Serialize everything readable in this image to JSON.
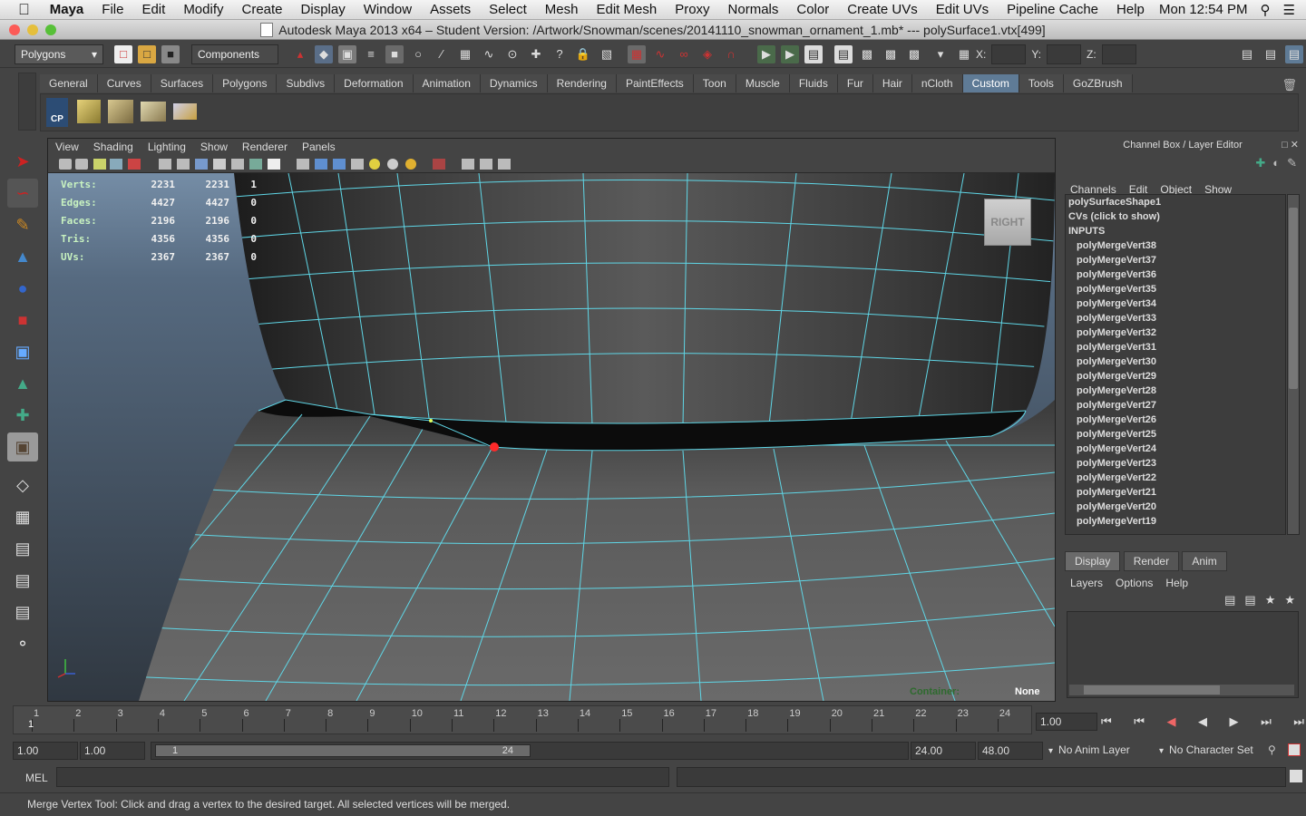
{
  "mac_menu": {
    "app": "Maya",
    "items": [
      "File",
      "Edit",
      "Modify",
      "Create",
      "Display",
      "Window",
      "Assets",
      "Select",
      "Mesh",
      "Edit Mesh",
      "Proxy",
      "Normals",
      "Color",
      "Create UVs",
      "Edit UVs",
      "Pipeline Cache",
      "Help"
    ],
    "clock": "Mon 12:54 PM"
  },
  "window_title": "Autodesk Maya 2013 x64 – Student Version: /Artwork/Snowman/scenes/20141110_snowman_ornament_1.mb*  ---   polySurface1.vtx[499]",
  "status_line": {
    "menu_set": "Polygons",
    "selection_mode": "Components",
    "x_label": "X:",
    "y_label": "Y:",
    "z_label": "Z:"
  },
  "shelf_tabs": [
    "General",
    "Curves",
    "Surfaces",
    "Polygons",
    "Subdivs",
    "Deformation",
    "Animation",
    "Dynamics",
    "Rendering",
    "PaintEffects",
    "Toon",
    "Muscle",
    "Fluids",
    "Fur",
    "Hair",
    "nCloth",
    "Custom",
    "Tools",
    "GoZBrush"
  ],
  "shelf_active": "Custom",
  "shelf_cp_label": "CP",
  "viewport": {
    "menu": [
      "View",
      "Shading",
      "Lighting",
      "Show",
      "Renderer",
      "Panels"
    ],
    "hud": [
      {
        "label": "Verts:",
        "a": "2231",
        "b": "2231",
        "c": "1"
      },
      {
        "label": "Edges:",
        "a": "4427",
        "b": "4427",
        "c": "0"
      },
      {
        "label": "Faces:",
        "a": "2196",
        "b": "2196",
        "c": "0"
      },
      {
        "label": "Tris:",
        "a": "4356",
        "b": "4356",
        "c": "0"
      },
      {
        "label": "UVs:",
        "a": "2367",
        "b": "2367",
        "c": "0"
      }
    ],
    "view_cube": "RIGHT",
    "container_label": "Container:",
    "container_value": "None"
  },
  "channel_box": {
    "title": "Channel Box / Layer Editor",
    "menu": [
      "Channels",
      "Edit",
      "Object",
      "Show"
    ],
    "items": [
      "polySurfaceShape1",
      "CVs (click to show)",
      "INPUTS",
      "polyMergeVert38",
      "polyMergeVert37",
      "polyMergeVert36",
      "polyMergeVert35",
      "polyMergeVert34",
      "polyMergeVert33",
      "polyMergeVert32",
      "polyMergeVert31",
      "polyMergeVert30",
      "polyMergeVert29",
      "polyMergeVert28",
      "polyMergeVert27",
      "polyMergeVert26",
      "polyMergeVert25",
      "polyMergeVert24",
      "polyMergeVert23",
      "polyMergeVert22",
      "polyMergeVert21",
      "polyMergeVert20",
      "polyMergeVert19"
    ]
  },
  "layer_editor": {
    "tabs": [
      "Display",
      "Render",
      "Anim"
    ],
    "menu": [
      "Layers",
      "Options",
      "Help"
    ]
  },
  "time_slider": {
    "ticks": [
      "1",
      "2",
      "3",
      "4",
      "5",
      "6",
      "7",
      "8",
      "9",
      "10",
      "11",
      "12",
      "13",
      "14",
      "15",
      "16",
      "17",
      "18",
      "19",
      "20",
      "21",
      "22",
      "23",
      "24"
    ],
    "current_marker": "1",
    "current_time": "1.00"
  },
  "range_slider": {
    "start": "1.00",
    "inner_start": "1.00",
    "range_left": "1",
    "range_right": "24",
    "end": "24.00",
    "anim_end": "48.00",
    "anim_layer": "No Anim Layer",
    "character_set": "No Character Set"
  },
  "mel_label": "MEL",
  "help_line": "Merge Vertex Tool: Click and drag a vertex to the desired target. All selected vertices will be merged.",
  "colors": {
    "wire": "#5fd6e6",
    "selected": "#ff2a2a",
    "accent": "#5f7b96"
  }
}
